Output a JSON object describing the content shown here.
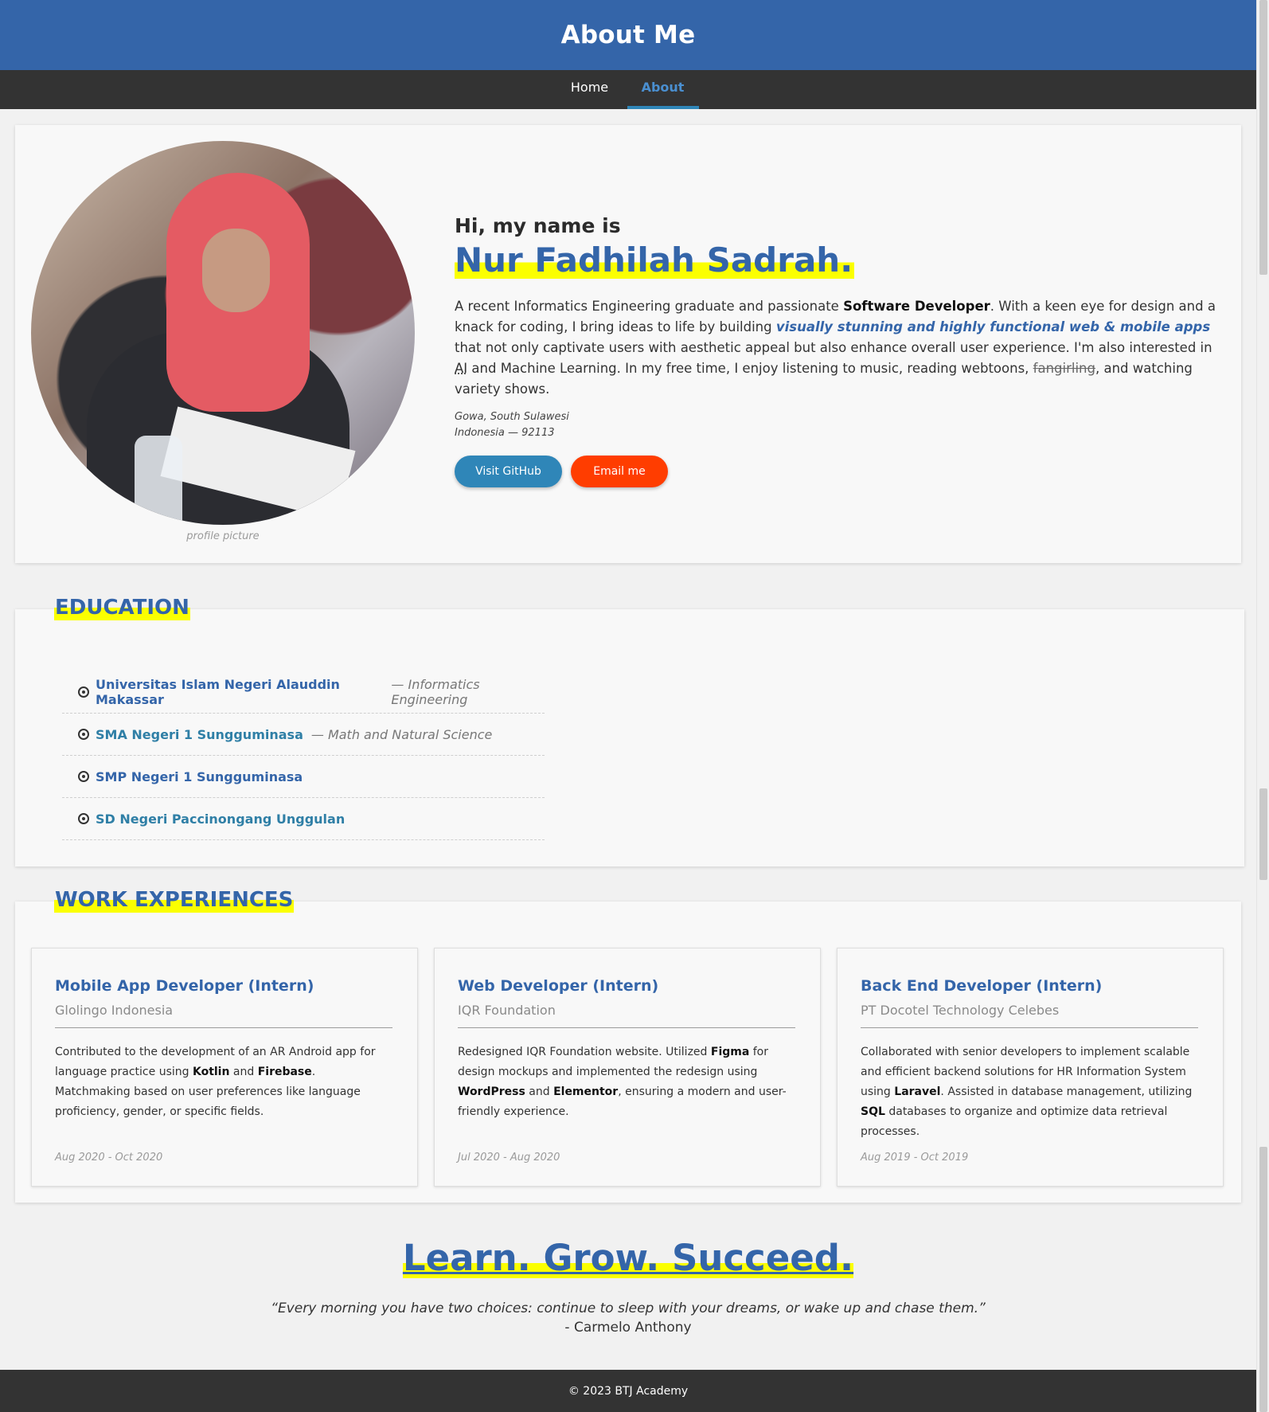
{
  "header": {
    "title": "About Me"
  },
  "nav": {
    "home": "Home",
    "about": "About"
  },
  "profile": {
    "caption": "profile picture",
    "greeting": "Hi, my name is",
    "name": "Nur Fadhilah Sadrah.",
    "bio": {
      "p1": "A recent Informatics Engineering graduate and passionate ",
      "role": "Software Developer",
      "p2": ". With a keen eye for design and a knack for coding, I bring ideas to life by building ",
      "highlight": "visually stunning and highly functional web & mobile apps",
      "p3": " that not only captivate users with aesthetic appeal but also enhance overall user experience. I'm also interested in ",
      "ai": "AI",
      "p4": " and Machine Learning. In my free time, I enjoy listening to music, reading webtoons, ",
      "strike": "fangirling",
      "p5": ", and watching variety shows."
    },
    "address": {
      "line1": "Gowa, South Sulawesi",
      "line2": "Indonesia — 92113"
    },
    "buttons": {
      "github": "Visit GitHub",
      "email": "Email me"
    }
  },
  "education": {
    "title": "EDUCATION",
    "items": [
      {
        "school": "Universitas Islam Negeri Alauddin Makassar",
        "major": "— Informatics Engineering"
      },
      {
        "school": "SMA Negeri 1 Sungguminasa",
        "major": "— Math and Natural Science"
      },
      {
        "school": "SMP Negeri 1 Sungguminasa",
        "major": ""
      },
      {
        "school": "SD Negeri Paccinongang Unggulan",
        "major": ""
      }
    ]
  },
  "work": {
    "title": "WORK EXPERIENCES",
    "jobs": [
      {
        "title": "Mobile App Developer (Intern)",
        "company": "Glolingo Indonesia",
        "d1": "Contributed to the development of an AR Android app for language practice using ",
        "b1": "Kotlin",
        "d2": " and ",
        "b2": "Firebase",
        "d3": ". Matchmaking based on user preferences like language proficiency, gender, or specific fields.",
        "date": "Aug 2020 - Oct 2020"
      },
      {
        "title": "Web Developer (Intern)",
        "company": "IQR Foundation",
        "d1": "Redesigned IQR Foundation website. Utilized ",
        "b1": "Figma",
        "d2": " for design mockups and implemented the redesign using ",
        "b2": "WordPress",
        "d3": " and ",
        "b3": "Elementor",
        "d4": ", ensuring a modern and user-friendly experience.",
        "date": "Jul 2020 - Aug 2020"
      },
      {
        "title": "Back End Developer (Intern)",
        "company": "PT Docotel Technology Celebes",
        "d1": "Collaborated with senior developers to implement scalable and efficient backend solutions for HR Information System using ",
        "b1": "Laravel",
        "d2": ". Assisted in database management, utilizing ",
        "b2": "SQL",
        "d3": " databases to organize and optimize data retrieval processes.",
        "date": "Aug 2019 - Oct 2019"
      }
    ]
  },
  "motto": {
    "title": "Learn. Grow. Succeed.",
    "quote": "“Every morning you have two choices: continue to sleep with your dreams, or wake up and chase them.”",
    "author": "- Carmelo Anthony"
  },
  "footer": {
    "text": "© 2023 BTJ Academy"
  },
  "colors": {
    "primary": "#3465a9",
    "highlight": "#fbff00",
    "github": "#2f86b8",
    "email": "#ff3d00",
    "dark": "#333333"
  }
}
